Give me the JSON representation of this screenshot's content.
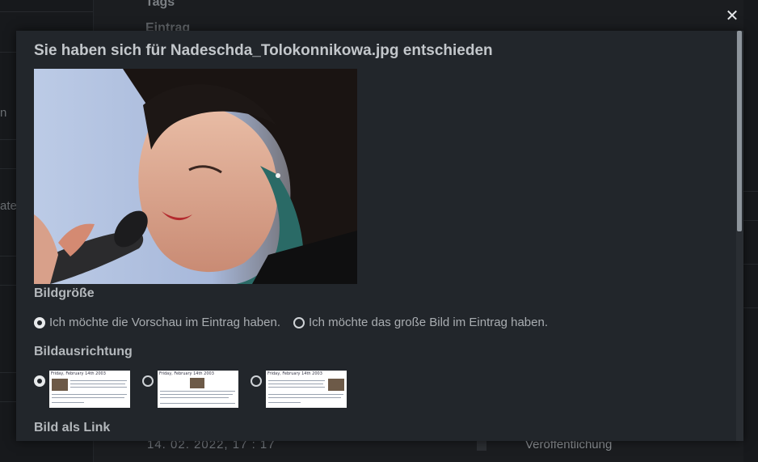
{
  "background": {
    "top_label": "Tags",
    "second_label": "Eintrag",
    "left_fragment_1": "n",
    "left_fragment_2": "ate",
    "date_value": "14. 02. 2022, 17 : 17",
    "publish_label": "Veröffentlichung"
  },
  "modal": {
    "close_symbol": "✕",
    "title": "Sie haben sich für Nadeschda_Tolokonnikowa.jpg entschieden",
    "image_alt": "Nadeschda_Tolokonnikowa.jpg",
    "size_heading": "Bildgröße",
    "size_options": [
      {
        "label": "Ich möchte die Vorschau im Eintrag haben.",
        "checked": true
      },
      {
        "label": "Ich möchte das große Bild im Eintrag haben.",
        "checked": false
      }
    ],
    "alignment_heading": "Bildausrichtung",
    "alignment_options": [
      {
        "preview_date": "Friday, February 14th 2003",
        "image_side": "left",
        "checked": true
      },
      {
        "preview_date": "Friday, February 14th 2003",
        "image_side": "center",
        "checked": false
      },
      {
        "preview_date": "Friday, February 14th 2003",
        "image_side": "right",
        "checked": false
      }
    ],
    "link_heading": "Bild als Link"
  },
  "colors": {
    "modal_bg": "#22262b",
    "overlay_bg": "#151719",
    "text": "#a9adb1"
  }
}
